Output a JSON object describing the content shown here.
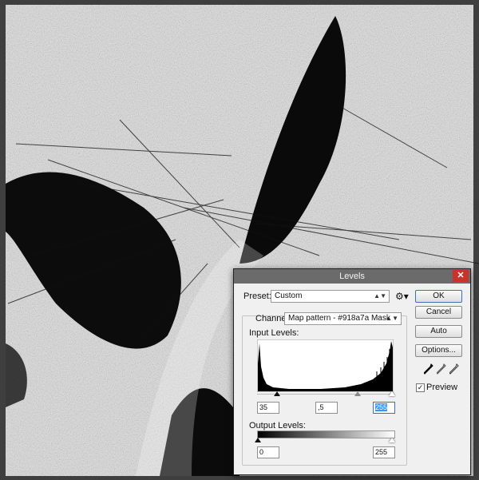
{
  "dialog": {
    "title": "Levels",
    "close_glyph": "✕",
    "preset_label": "Preset:",
    "preset_value": "Custom",
    "channel_label": "Channel:",
    "channel_value": "Map pattern - #918a7a Mask",
    "input_levels_label": "Input Levels:",
    "output_levels_label": "Output Levels:",
    "input_black": "35",
    "input_gamma": ",5",
    "input_white": "255",
    "output_black": "0",
    "output_white": "255",
    "buttons": {
      "ok": "OK",
      "cancel": "Cancel",
      "auto": "Auto",
      "options": "Options..."
    },
    "preview_label": "Preview",
    "preview_checked": true,
    "eyedroppers": [
      "black-eyedropper-icon",
      "gray-eyedropper-icon",
      "white-eyedropper-icon"
    ]
  },
  "colors": {
    "title_bar": "#6b6b6b",
    "close_button": "#c8332a",
    "dialog_bg": "#f0f0f0",
    "selection": "#3399ff"
  }
}
